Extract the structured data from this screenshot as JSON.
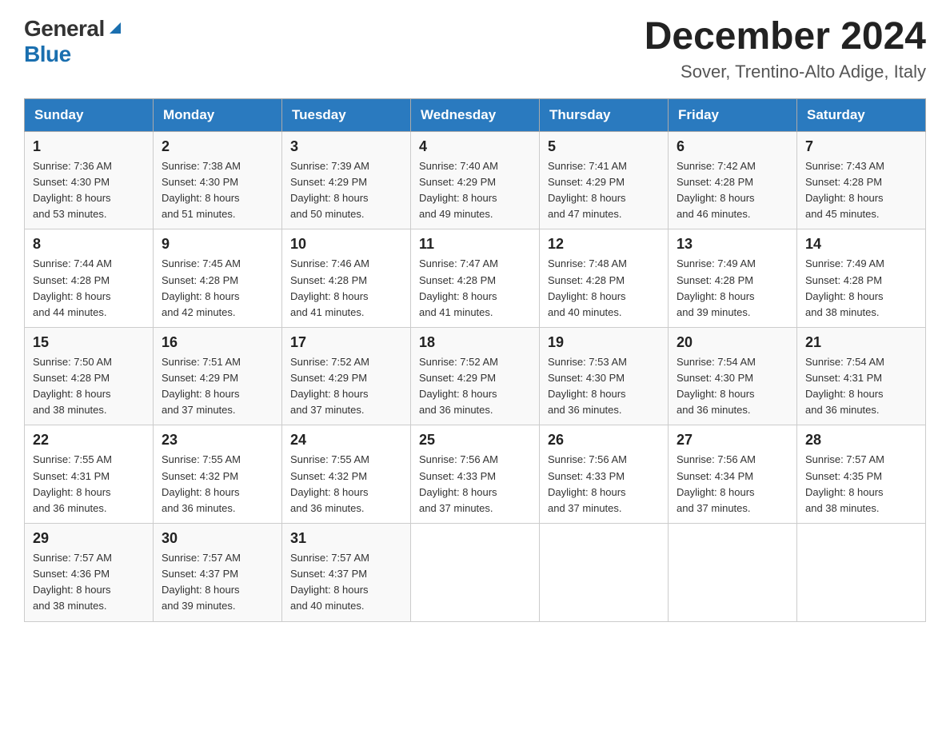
{
  "logo": {
    "general": "General",
    "blue": "Blue"
  },
  "header": {
    "title": "December 2024",
    "subtitle": "Sover, Trentino-Alto Adige, Italy"
  },
  "days_of_week": [
    "Sunday",
    "Monday",
    "Tuesday",
    "Wednesday",
    "Thursday",
    "Friday",
    "Saturday"
  ],
  "weeks": [
    [
      {
        "day": "1",
        "sunrise": "7:36 AM",
        "sunset": "4:30 PM",
        "daylight": "8 hours and 53 minutes."
      },
      {
        "day": "2",
        "sunrise": "7:38 AM",
        "sunset": "4:30 PM",
        "daylight": "8 hours and 51 minutes."
      },
      {
        "day": "3",
        "sunrise": "7:39 AM",
        "sunset": "4:29 PM",
        "daylight": "8 hours and 50 minutes."
      },
      {
        "day": "4",
        "sunrise": "7:40 AM",
        "sunset": "4:29 PM",
        "daylight": "8 hours and 49 minutes."
      },
      {
        "day": "5",
        "sunrise": "7:41 AM",
        "sunset": "4:29 PM",
        "daylight": "8 hours and 47 minutes."
      },
      {
        "day": "6",
        "sunrise": "7:42 AM",
        "sunset": "4:28 PM",
        "daylight": "8 hours and 46 minutes."
      },
      {
        "day": "7",
        "sunrise": "7:43 AM",
        "sunset": "4:28 PM",
        "daylight": "8 hours and 45 minutes."
      }
    ],
    [
      {
        "day": "8",
        "sunrise": "7:44 AM",
        "sunset": "4:28 PM",
        "daylight": "8 hours and 44 minutes."
      },
      {
        "day": "9",
        "sunrise": "7:45 AM",
        "sunset": "4:28 PM",
        "daylight": "8 hours and 42 minutes."
      },
      {
        "day": "10",
        "sunrise": "7:46 AM",
        "sunset": "4:28 PM",
        "daylight": "8 hours and 41 minutes."
      },
      {
        "day": "11",
        "sunrise": "7:47 AM",
        "sunset": "4:28 PM",
        "daylight": "8 hours and 41 minutes."
      },
      {
        "day": "12",
        "sunrise": "7:48 AM",
        "sunset": "4:28 PM",
        "daylight": "8 hours and 40 minutes."
      },
      {
        "day": "13",
        "sunrise": "7:49 AM",
        "sunset": "4:28 PM",
        "daylight": "8 hours and 39 minutes."
      },
      {
        "day": "14",
        "sunrise": "7:49 AM",
        "sunset": "4:28 PM",
        "daylight": "8 hours and 38 minutes."
      }
    ],
    [
      {
        "day": "15",
        "sunrise": "7:50 AM",
        "sunset": "4:28 PM",
        "daylight": "8 hours and 38 minutes."
      },
      {
        "day": "16",
        "sunrise": "7:51 AM",
        "sunset": "4:29 PM",
        "daylight": "8 hours and 37 minutes."
      },
      {
        "day": "17",
        "sunrise": "7:52 AM",
        "sunset": "4:29 PM",
        "daylight": "8 hours and 37 minutes."
      },
      {
        "day": "18",
        "sunrise": "7:52 AM",
        "sunset": "4:29 PM",
        "daylight": "8 hours and 36 minutes."
      },
      {
        "day": "19",
        "sunrise": "7:53 AM",
        "sunset": "4:30 PM",
        "daylight": "8 hours and 36 minutes."
      },
      {
        "day": "20",
        "sunrise": "7:54 AM",
        "sunset": "4:30 PM",
        "daylight": "8 hours and 36 minutes."
      },
      {
        "day": "21",
        "sunrise": "7:54 AM",
        "sunset": "4:31 PM",
        "daylight": "8 hours and 36 minutes."
      }
    ],
    [
      {
        "day": "22",
        "sunrise": "7:55 AM",
        "sunset": "4:31 PM",
        "daylight": "8 hours and 36 minutes."
      },
      {
        "day": "23",
        "sunrise": "7:55 AM",
        "sunset": "4:32 PM",
        "daylight": "8 hours and 36 minutes."
      },
      {
        "day": "24",
        "sunrise": "7:55 AM",
        "sunset": "4:32 PM",
        "daylight": "8 hours and 36 minutes."
      },
      {
        "day": "25",
        "sunrise": "7:56 AM",
        "sunset": "4:33 PM",
        "daylight": "8 hours and 37 minutes."
      },
      {
        "day": "26",
        "sunrise": "7:56 AM",
        "sunset": "4:33 PM",
        "daylight": "8 hours and 37 minutes."
      },
      {
        "day": "27",
        "sunrise": "7:56 AM",
        "sunset": "4:34 PM",
        "daylight": "8 hours and 37 minutes."
      },
      {
        "day": "28",
        "sunrise": "7:57 AM",
        "sunset": "4:35 PM",
        "daylight": "8 hours and 38 minutes."
      }
    ],
    [
      {
        "day": "29",
        "sunrise": "7:57 AM",
        "sunset": "4:36 PM",
        "daylight": "8 hours and 38 minutes."
      },
      {
        "day": "30",
        "sunrise": "7:57 AM",
        "sunset": "4:37 PM",
        "daylight": "8 hours and 39 minutes."
      },
      {
        "day": "31",
        "sunrise": "7:57 AM",
        "sunset": "4:37 PM",
        "daylight": "8 hours and 40 minutes."
      },
      null,
      null,
      null,
      null
    ]
  ],
  "labels": {
    "sunrise": "Sunrise:",
    "sunset": "Sunset:",
    "daylight": "Daylight:"
  }
}
